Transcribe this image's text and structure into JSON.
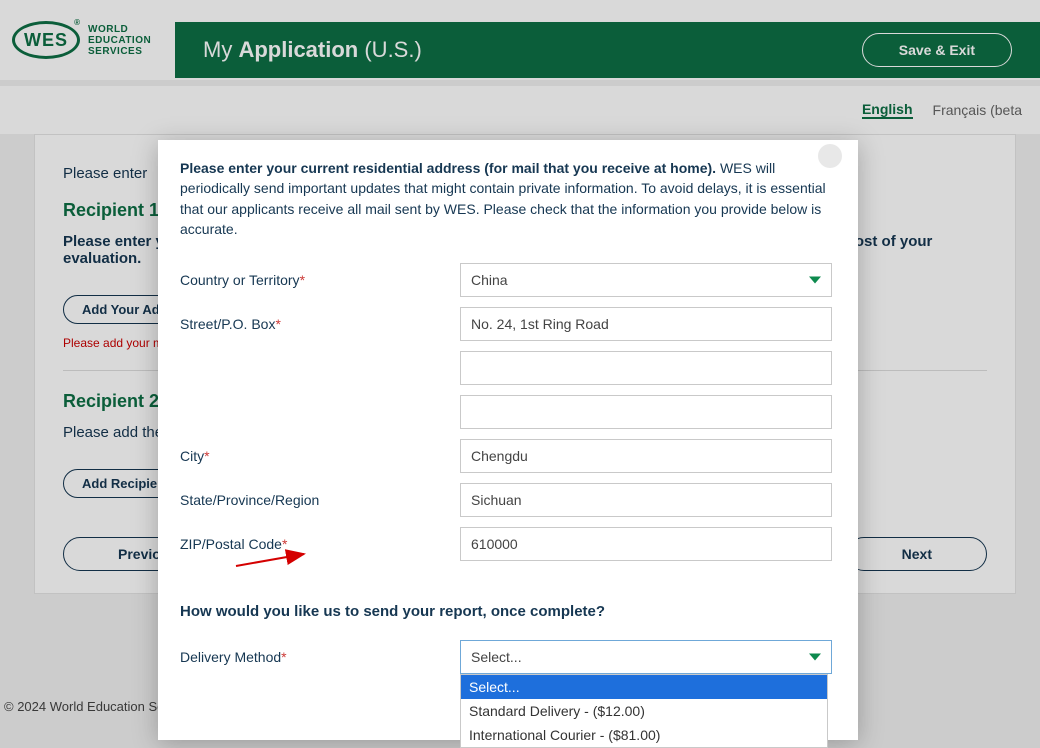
{
  "logo": {
    "abbrev": "WES",
    "line1": "WORLD",
    "line2": "EDUCATION",
    "line3": "SERVICES"
  },
  "header": {
    "my": "My",
    "app": "Application",
    "region": "(U.S.)",
    "save_exit": "Save & Exit"
  },
  "lang": {
    "en": "English",
    "fr": "Français (beta"
  },
  "bgpage": {
    "enter": "Please enter",
    "recipient1_title": "Recipient 1",
    "recipient1_body": "Please enter your current residential address. One copy of your report will be sent here and is included in the cost of your evaluation.",
    "add_address": "Add Your Address",
    "error": "Please add your ma",
    "recipient2_title": "Recipient 2",
    "recipient2_body": "Please add the institution(s) that will receive your official WES credential evaluation report for handling.",
    "add_recipient": "Add Recipient",
    "prev": "Previous",
    "next": "Next"
  },
  "footer": {
    "copyright": "© 2024 World Education Serv"
  },
  "modal": {
    "lead_strong": "Please enter your current residential address (for mail that you receive at home).",
    "lead_rest": " WES will periodically send important updates that might contain private information. To avoid delays, it is essential that our applicants receive all mail sent by WES. Please check that the information you provide below is accurate.",
    "labels": {
      "country": "Country or Territory",
      "street": "Street/P.O. Box",
      "city": "City",
      "state": "State/Province/Region",
      "zip": "ZIP/Postal Code",
      "delivery": "Delivery Method"
    },
    "values": {
      "country": "China",
      "street": "No. 24, 1st Ring Road",
      "city": "Chengdu",
      "state": "Sichuan",
      "zip": "610000",
      "delivery": "Select..."
    },
    "send_q": "How would you like us to send your report, once complete?",
    "dd": {
      "opt0": "Select...",
      "opt1": "Standard Delivery - ($12.00)",
      "opt2": "International Courier - ($81.00)"
    }
  }
}
